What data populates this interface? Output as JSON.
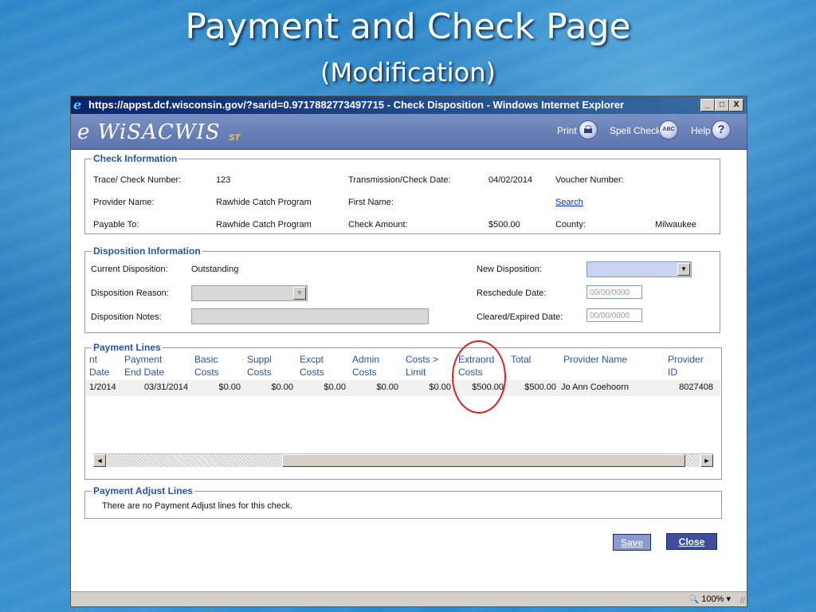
{
  "slide": {
    "title": "Payment and Check Page",
    "subtitle": "(Modification)"
  },
  "window": {
    "title": "https://appst.dcf.wisconsin.gov/?sarid=0.9717882773497715 - Check Disposition - Windows Internet Explorer",
    "minimize": "_",
    "maximize": "□",
    "close": "X"
  },
  "header": {
    "logo": "e WiSACWIS",
    "logo_suffix": "ST",
    "print": "Print",
    "spell_check": "Spell Check",
    "help": "Help",
    "help_glyph": "?",
    "spell_glyph": "ABC"
  },
  "check_info": {
    "legend": "Check Information",
    "trace_label": "Trace/ Check Number:",
    "trace_value": "123",
    "transmission_label": "Transmission/Check Date:",
    "transmission_value": "04/02/2014",
    "voucher_label": "Voucher Number:",
    "provider_label": "Provider Name:",
    "provider_value": "Rawhide Catch Program",
    "first_name_label": "First Name:",
    "search_link": "Search",
    "payable_label": "Payable To:",
    "payable_value": "Rawhide Catch Program",
    "amount_label": "Check Amount:",
    "amount_value": "$500.00",
    "county_label": "County:",
    "county_value": "Milwaukee"
  },
  "disposition": {
    "legend": "Disposition Information",
    "current_label": "Current Disposition:",
    "current_value": "Outstanding",
    "new_label": "New Disposition:",
    "new_value": "",
    "reason_label": "Disposition Reason:",
    "reschedule_label": "Reschedule Date:",
    "reschedule_placeholder": "00/00/0000",
    "notes_label": "Disposition Notes:",
    "cleared_label": "Cleared/Expired Date:",
    "cleared_placeholder": "00/00/0000"
  },
  "payment_lines": {
    "legend": "Payment Lines",
    "columns": [
      {
        "l1": "nt",
        "l2": "Date"
      },
      {
        "l1": "Payment",
        "l2": "End Date"
      },
      {
        "l1": "Basic",
        "l2": "Costs"
      },
      {
        "l1": "Suppl",
        "l2": "Costs"
      },
      {
        "l1": "Excpt",
        "l2": "Costs"
      },
      {
        "l1": "Admin",
        "l2": "Costs"
      },
      {
        "l1": "Costs >",
        "l2": "Limit"
      },
      {
        "l1": "Extraord",
        "l2": "Costs"
      },
      {
        "l1": "Total",
        "l2": ""
      },
      {
        "l1": "Provider Name",
        "l2": ""
      },
      {
        "l1": "Provider",
        "l2": "ID"
      }
    ],
    "rows": [
      [
        "1/2014",
        "03/31/2014",
        "$0.00",
        "$0.00",
        "$0.00",
        "$0.00",
        "$0.00",
        "$500.00",
        "$500.00",
        "Jo Ann Coehoorn",
        "8027408"
      ]
    ],
    "scroll_left": "◄",
    "scroll_right": "►"
  },
  "adjust_lines": {
    "legend": "Payment Adjust Lines",
    "message": "There are no Payment Adjust lines for this check."
  },
  "buttons": {
    "save": "Save",
    "close": "Close"
  },
  "status": {
    "zoom": "100%",
    "zoom_glyph": "🔍",
    "zoom_arrow": "▾",
    "grip": "//"
  },
  "colors": {
    "highlight_circle": "#e02020",
    "header_blue": "#5b73ad",
    "legend_blue": "#2554a8"
  }
}
